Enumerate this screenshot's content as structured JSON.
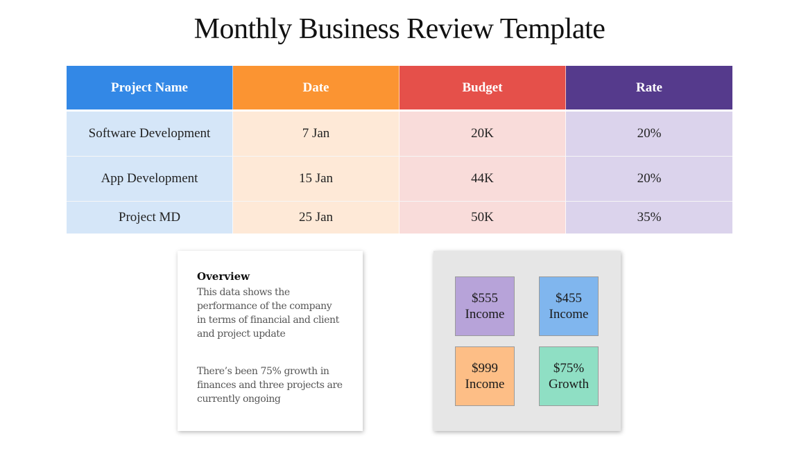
{
  "title": "Monthly Business Review Template",
  "table": {
    "headers": [
      {
        "label": "Project Name",
        "color": "#3388E6"
      },
      {
        "label": "Date",
        "color": "#FB9432"
      },
      {
        "label": "Budget",
        "color": "#E5504A"
      },
      {
        "label": "Rate",
        "color": "#553A8C"
      }
    ],
    "column_tints": [
      "#D5E6F8",
      "#FEE9D7",
      "#F9DCDA",
      "#DBD3EC"
    ],
    "rows": [
      [
        "Software Development",
        "7 Jan",
        "20K",
        "20%"
      ],
      [
        "App Development",
        "15 Jan",
        "44K",
        "20%"
      ],
      [
        "Project MD",
        "25 Jan",
        "50K",
        "35%"
      ]
    ]
  },
  "overview": {
    "heading": "Overview",
    "paragraph1": "This data shows the performance of the company in terms of financial and client and project update",
    "paragraph2": "There’s been 75% growth in finances and three projects are currently ongoing"
  },
  "metrics": [
    {
      "value": "$555",
      "label": "Income",
      "color": "#B7A3D9"
    },
    {
      "value": "$455",
      "label": "Income",
      "color": "#80B6EE"
    },
    {
      "value": "$999",
      "label": "Income",
      "color": "#FDBE86"
    },
    {
      "value": "$75%",
      "label": "Growth",
      "color": "#8FDFC4"
    }
  ]
}
